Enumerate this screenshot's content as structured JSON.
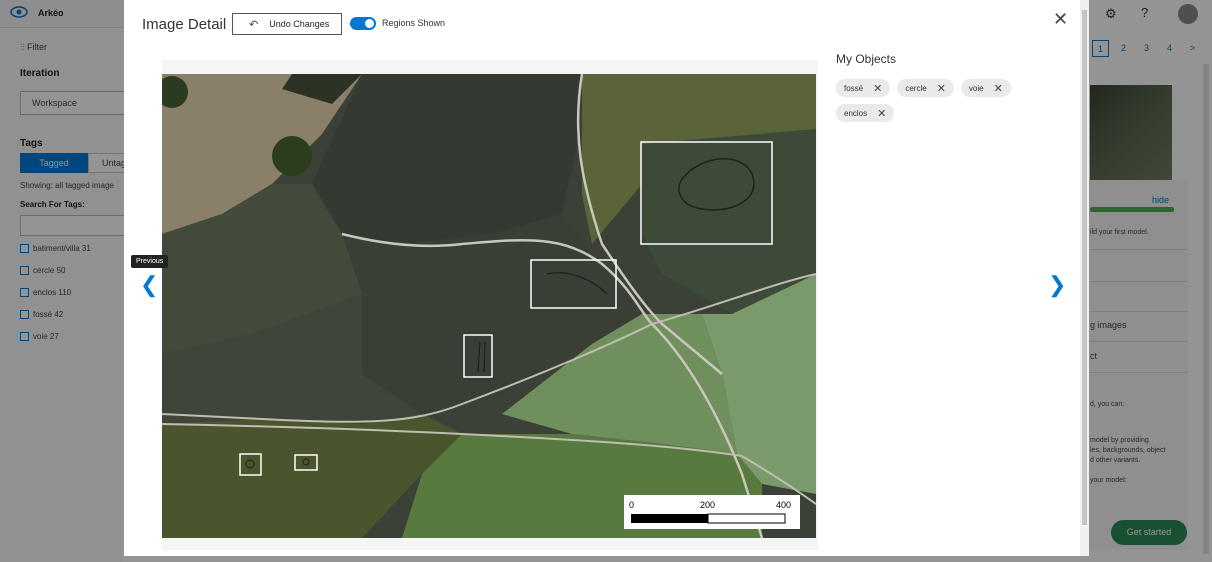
{
  "app": {
    "name": "Arkéo",
    "filter_label": "Filter",
    "iteration_heading": "Iteration",
    "workspace_value": "Workspace",
    "tags_heading": "Tags",
    "tagged_label": "Tagged",
    "untagged_label": "Untag",
    "showing_text": "Showing: all tagged image",
    "search_for_tags_label": "Search For Tags:",
    "tag_list": [
      {
        "label": "batiment/villa  31"
      },
      {
        "label": "cercle  50"
      },
      {
        "label": "enclos  110"
      },
      {
        "label": "fossé  42"
      },
      {
        "label": "voie  27"
      }
    ],
    "pages": [
      "1",
      "2",
      "3",
      "4",
      ">"
    ],
    "hide_label": "hide",
    "side_texts": [
      "ild your first model.",
      "g images",
      "ct",
      "d, you can:",
      "model by providing",
      "les, backgrounds, object",
      "d other variants.",
      "your model:"
    ],
    "get_started_label": "Get started",
    "help_label": "?",
    "settings_icon": "gear-icon"
  },
  "modal": {
    "title": "Image Detail",
    "undo_label": "Undo Changes",
    "regions_label": "Regions Shown",
    "regions_shown": true,
    "close_symbol": "✕",
    "prev_tooltip": "Previous",
    "objects_title": "My Objects",
    "objects": [
      {
        "label": "fossé"
      },
      {
        "label": "cercle"
      },
      {
        "label": "voie"
      },
      {
        "label": "enclos"
      }
    ],
    "scale_bar": {
      "labels": [
        "0",
        "200",
        "400"
      ]
    },
    "accent_color": "#0078d4"
  }
}
